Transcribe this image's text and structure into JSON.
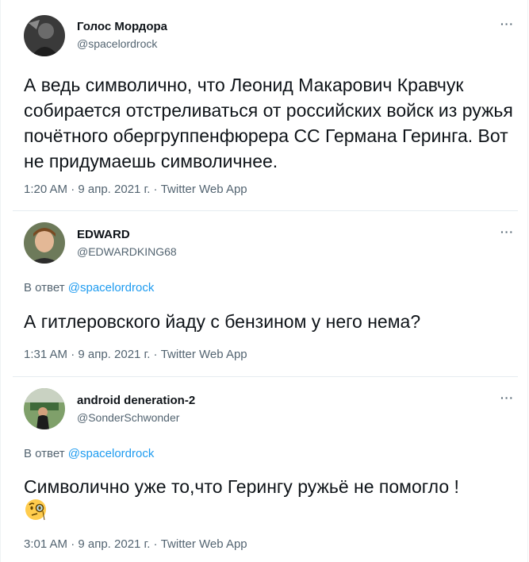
{
  "tweets": [
    {
      "name": "Голос Мордора",
      "handle": "@spacelordrock",
      "text": "А ведь символично, что Леонид Макарович Кравчук собирается отстреливаться от российских войск из ружья почётного обергруппенфюрера СС Германа Геринга. Вот не придумаешь символичнее.",
      "meta": "1:20 AM · 9 апр. 2021 г. · Twitter Web App",
      "more": "···"
    },
    {
      "name": "EDWARD",
      "handle": "@EDWARDKING68",
      "reply_prefix": "В ответ",
      "reply_handle": "@spacelordrock",
      "text": "А гитлеровского йаду с бензином у него нема?",
      "meta": "1:31 AM · 9 апр. 2021 г. · Twitter Web App",
      "more": "···"
    },
    {
      "name": "android deneration-2",
      "handle": "@SonderSchwonder",
      "reply_prefix": "В ответ",
      "reply_handle": "@spacelordrock",
      "text": "Символично уже то,что Герингу ружьё не помогло !",
      "emoji": "face-with-monocle",
      "meta": "3:01 AM · 9 апр. 2021 г. · Twitter Web App",
      "more": "···"
    }
  ]
}
